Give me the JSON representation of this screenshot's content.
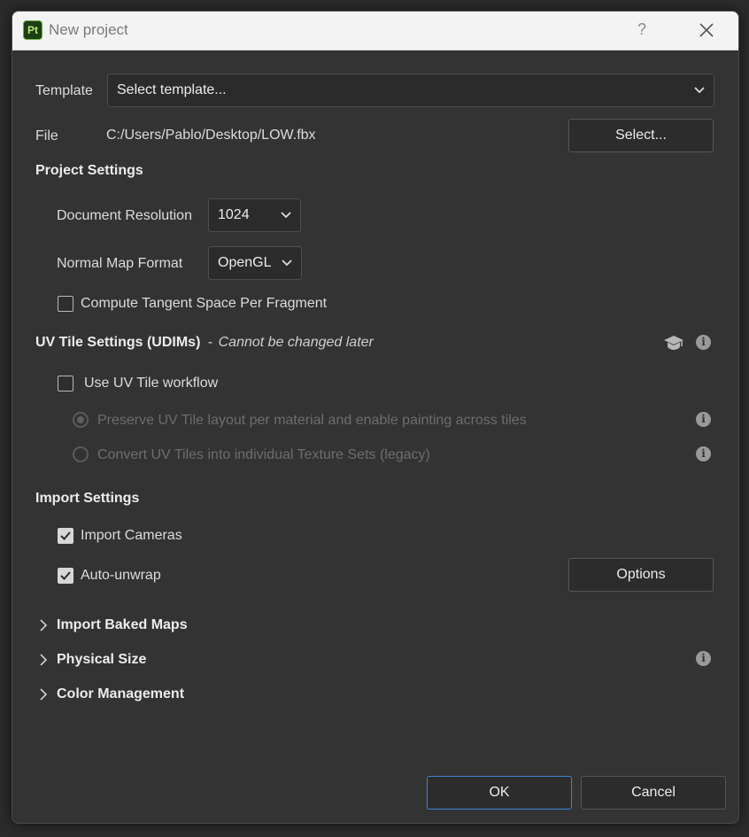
{
  "window": {
    "title": "New project",
    "app_logo_text": "Pt",
    "help_label": "?",
    "accent": "#3d84d6",
    "logo_color": "#67b23f"
  },
  "template": {
    "label": "Template",
    "selected": "Select template..."
  },
  "file": {
    "label": "File",
    "path": "C:/Users/Pablo/Desktop/LOW.fbx",
    "select_button": "Select..."
  },
  "project_settings": {
    "heading": "Project Settings",
    "resolution_label": "Document Resolution",
    "resolution_value": "1024",
    "normal_map_label": "Normal Map Format",
    "normal_map_value": "OpenGL",
    "tangent_label": "Compute Tangent Space Per Fragment",
    "tangent_checked": false
  },
  "uv_tile": {
    "heading": "UV Tile Settings (UDIMs)",
    "separator": "-",
    "note": "Cannot be changed later",
    "use_workflow_label": "Use UV Tile workflow",
    "use_workflow_checked": false,
    "option_preserve": "Preserve UV Tile layout per material and enable painting across tiles",
    "option_convert": "Convert UV Tiles into individual Texture Sets (legacy)",
    "selected_option": "preserve"
  },
  "import_settings": {
    "heading": "Import Settings",
    "import_cameras_label": "Import Cameras",
    "import_cameras_checked": true,
    "auto_unwrap_label": "Auto-unwrap",
    "auto_unwrap_checked": true,
    "options_button": "Options"
  },
  "sections": {
    "baked_maps": "Import Baked Maps",
    "physical_size": "Physical Size",
    "color_management": "Color Management"
  },
  "footer": {
    "ok": "OK",
    "cancel": "Cancel"
  },
  "info_glyph": "i"
}
